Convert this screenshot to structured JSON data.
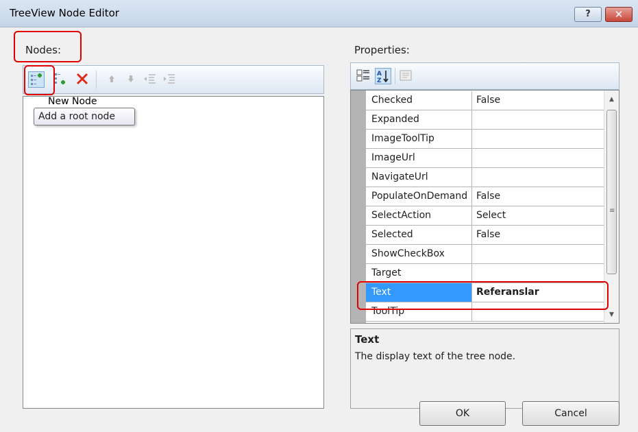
{
  "window": {
    "title": "TreeView Node Editor",
    "help_label": "?",
    "close_label": "✕"
  },
  "nodes_panel": {
    "label": "Nodes:",
    "toolbar": [
      {
        "name": "add-root-node-icon"
      },
      {
        "name": "add-child-node-icon"
      },
      {
        "name": "delete-node-icon"
      },
      {
        "name": "move-up-icon"
      },
      {
        "name": "move-down-icon"
      },
      {
        "name": "outdent-icon"
      },
      {
        "name": "indent-icon"
      }
    ],
    "tree_item": "New Node",
    "tooltip": "Add a root node"
  },
  "properties_panel": {
    "label": "Properties:",
    "toolbar": [
      {
        "name": "categorized-icon"
      },
      {
        "name": "alphabetical-icon"
      },
      {
        "name": "property-pages-icon"
      }
    ],
    "rows": [
      {
        "name": "Checked",
        "value": "False"
      },
      {
        "name": "Expanded",
        "value": ""
      },
      {
        "name": "ImageToolTip",
        "value": ""
      },
      {
        "name": "ImageUrl",
        "value": ""
      },
      {
        "name": "NavigateUrl",
        "value": ""
      },
      {
        "name": "PopulateOnDemand",
        "value": "False"
      },
      {
        "name": "SelectAction",
        "value": "Select"
      },
      {
        "name": "Selected",
        "value": "False"
      },
      {
        "name": "ShowCheckBox",
        "value": ""
      },
      {
        "name": "Target",
        "value": ""
      },
      {
        "name": "Text",
        "value": "Referanslar",
        "selected": true
      },
      {
        "name": "ToolTip",
        "value": ""
      }
    ],
    "description_title": "Text",
    "description_text": "The display text of the tree node."
  },
  "buttons": {
    "ok": "OK",
    "cancel": "Cancel"
  }
}
